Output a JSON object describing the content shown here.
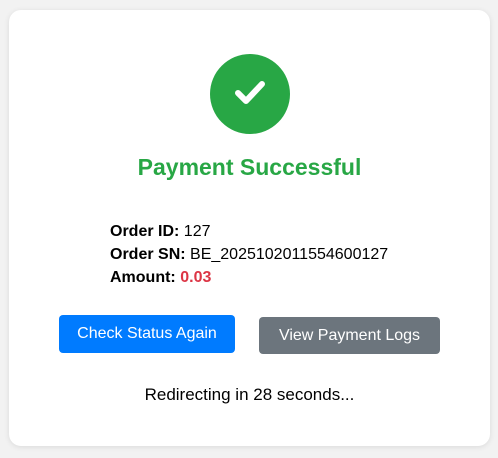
{
  "status": {
    "icon": "check-icon",
    "title": "Payment Successful",
    "color": "#28a745"
  },
  "order": {
    "id_label": "Order ID:",
    "id_value": "127",
    "sn_label": "Order SN:",
    "sn_value": "BE_2025102011554600127",
    "amount_label": "Amount:",
    "amount_value": "0.03",
    "amount_color": "#dc3545"
  },
  "actions": {
    "check_status_label": "Check Status Again",
    "check_status_color": "#007bff",
    "view_logs_label": "View Payment Logs",
    "view_logs_color": "#6c757d"
  },
  "redirect": {
    "text": "Redirecting in 28 seconds..."
  }
}
